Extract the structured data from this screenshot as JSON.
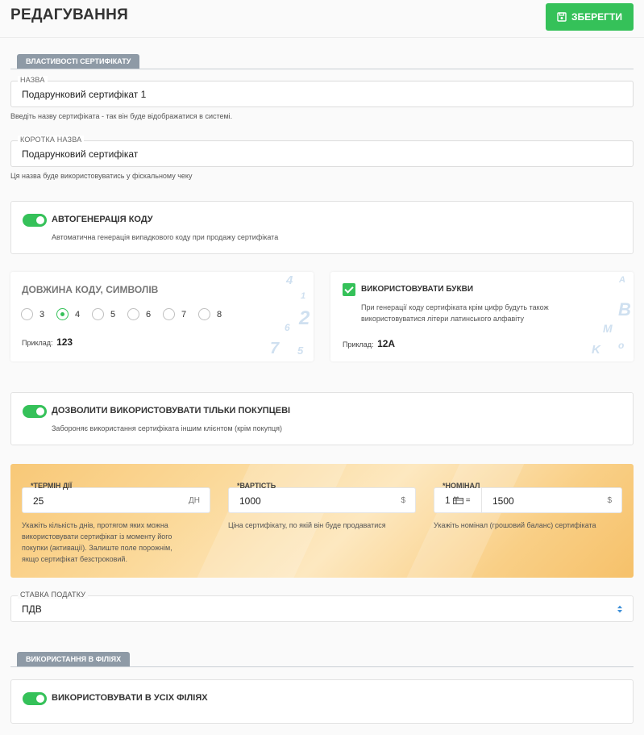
{
  "header": {
    "title": "РЕДАГУВАННЯ",
    "save_label": "ЗБЕРЕГТИ"
  },
  "properties": {
    "section_label": "ВЛАСТИВОСТІ СЕРТИФІКАТУ",
    "name": {
      "label": "НАЗВА",
      "value": "Подарунковий сертифікат 1",
      "hint": "Введіть назву сертифіката - так він буде відображатися в системі."
    },
    "short_name": {
      "label": "КОРОТКА НАЗВА",
      "value": "Подарунковий сертифікат",
      "hint": "Ця назва буде використовуватись у фіскальному чеку"
    }
  },
  "autogen": {
    "title": "АВТОГЕНЕРАЦІЯ КОДУ",
    "desc": "Автоматична генерація випадкового коду при продажу сертифіката",
    "enabled": true
  },
  "code_length": {
    "title": "ДОВЖИНА КОДУ, СИМВОЛІВ",
    "options": [
      "3",
      "4",
      "5",
      "6",
      "7",
      "8"
    ],
    "selected": "4",
    "example_label": "Приклад:",
    "example_value": "123",
    "deco_digits": [
      "4",
      "1",
      "2",
      "6",
      "7",
      "5"
    ]
  },
  "letters": {
    "title": "ВИКОРИСТОВУВАТИ БУКВИ",
    "desc_line1": "При генерації коду сертифіката крім цифр будуть також",
    "desc_line2": "використовуватися літери латинського алфавіту",
    "example_label": "Приклад:",
    "example_value": "12A",
    "checked": true,
    "deco_letters": [
      "A",
      "B",
      "M",
      "K",
      "o"
    ]
  },
  "buyer_only": {
    "title": "ДОЗВОЛИТИ ВИКОРИСТОВУВАТИ ТІЛЬКИ ПОКУПЦЕВІ",
    "desc": "Забороняє використання сертифіката іншим клієнтом (крім покупця)",
    "enabled": true
  },
  "validity": {
    "label": "*ТЕРМІН ДІЇ",
    "value": "25",
    "unit": "ДН",
    "hint_lines": [
      "Укажіть кількість днів, протягом яких можна",
      "використовувати сертифікат із моменту його",
      "покупки (активації). Залиште поле порожнім,",
      "якщо сертифікат безстроковий."
    ]
  },
  "price": {
    "label": "*ВАРТІСТЬ",
    "value": "1000",
    "unit": "$",
    "hint": "Ціна сертифікату, по якій він буде продаватися"
  },
  "nominal": {
    "label": "*НОМІНАЛ",
    "prefix": "1",
    "eq": "=",
    "value": "1500",
    "unit": "$",
    "hint": "Укажіть номінал (грошовий баланс) сертифіката"
  },
  "tax": {
    "label": "СТАВКА ПОДАТКУ",
    "value": "ПДВ"
  },
  "branches": {
    "section_label": "ВИКОРИСТАННЯ В ФІЛІЯХ",
    "all_title": "ВИКОРИСТОВУВАТИ В УСІХ ФІЛІЯХ",
    "enabled": true
  },
  "colors": {
    "accent": "#35c159",
    "section_tab": "#8e9aa6",
    "orange": "#f8c877"
  }
}
